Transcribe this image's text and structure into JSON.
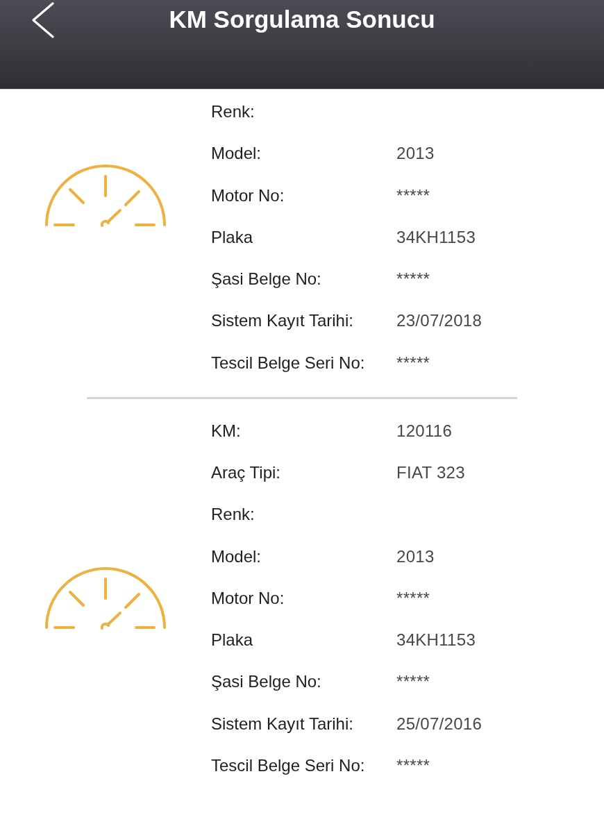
{
  "header": {
    "title": "KM Sorgulama Sonucu"
  },
  "records": [
    {
      "fields": [
        {
          "label": "Renk:"
        },
        {
          "label": "Model:",
          "value": "2013"
        },
        {
          "label": "Motor No:",
          "value": "*****"
        },
        {
          "label": "Plaka",
          "value": "34KH1153"
        },
        {
          "label": "Şasi Belge No:",
          "value": "*****"
        },
        {
          "label": "Sistem Kayıt Tarihi:",
          "value": "23/07/2018"
        },
        {
          "label": "Tescil Belge Seri No:",
          "value": "*****"
        }
      ]
    },
    {
      "fields": [
        {
          "label": "KM:",
          "value": "120116"
        },
        {
          "label": "Araç Tipi:",
          "value": "FIAT 323"
        },
        {
          "label": "Renk:"
        },
        {
          "label": "Model:",
          "value": "2013"
        },
        {
          "label": "Motor No:",
          "value": "*****"
        },
        {
          "label": "Plaka",
          "value": "34KH1153"
        },
        {
          "label": "Şasi Belge No:",
          "value": "*****"
        },
        {
          "label": "Sistem Kayıt Tarihi:",
          "value": "25/07/2016"
        },
        {
          "label": "Tescil Belge Seri No:",
          "value": "*****"
        }
      ]
    }
  ]
}
